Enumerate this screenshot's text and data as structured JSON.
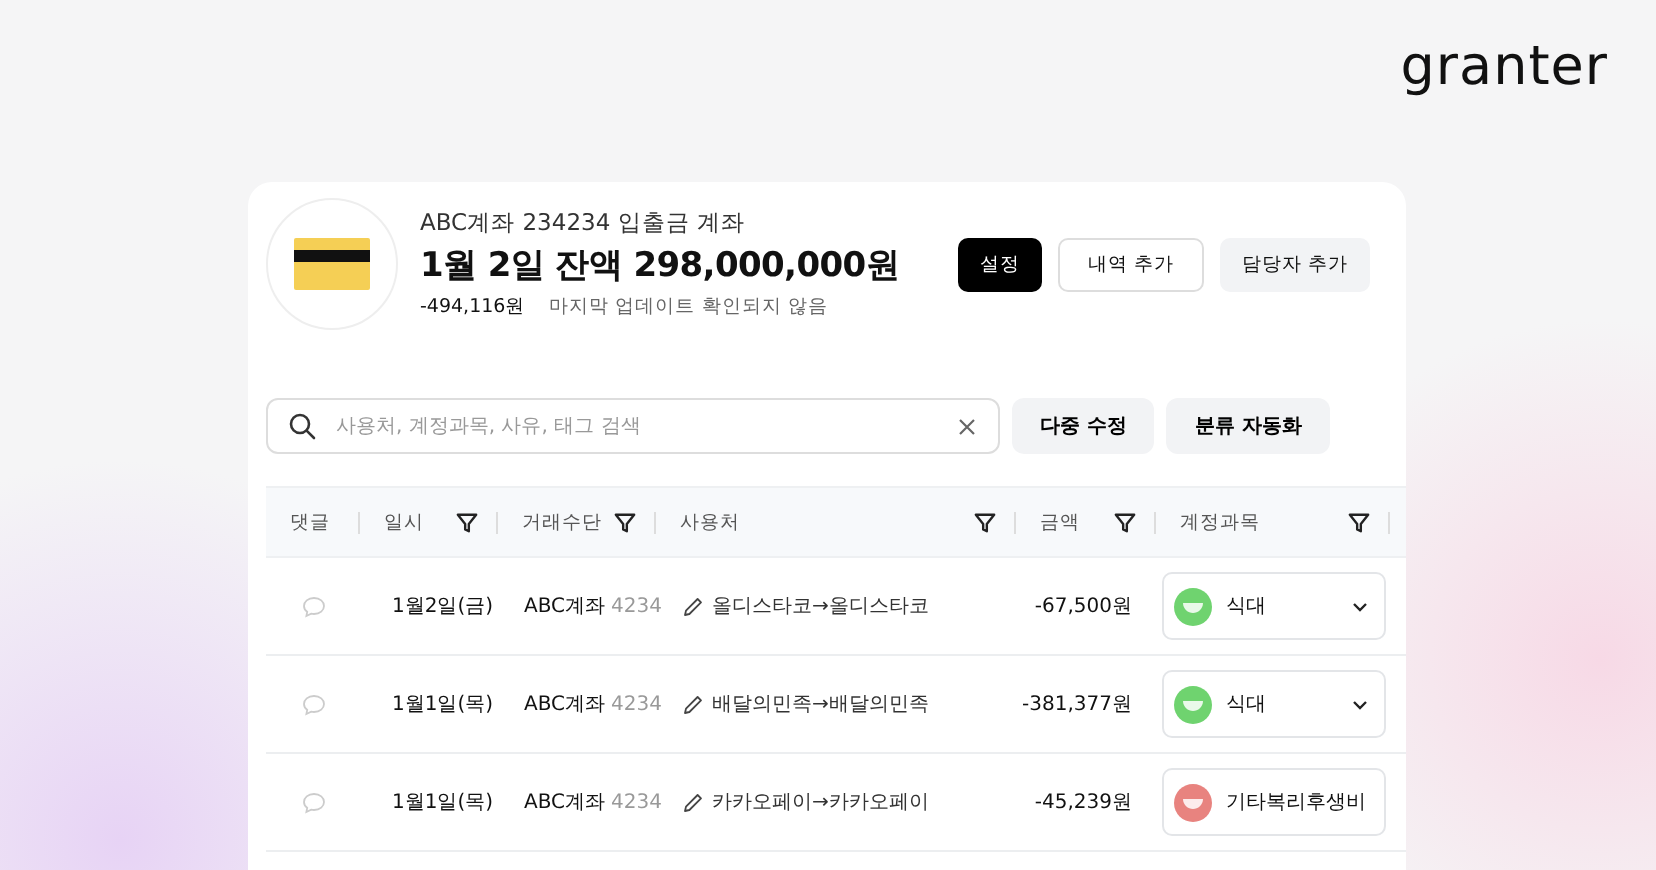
{
  "logo": "granter",
  "account": {
    "name": "ABC계좌 234234 입출금 계좌",
    "balance_title": "1월 2일 잔액 298,000,000원",
    "change": "-494,116원",
    "update_status": "마지막 업데이트 확인되지 않음"
  },
  "header_buttons": [
    {
      "label": "설정",
      "kind": "primary"
    },
    {
      "label": "내역 추가",
      "kind": "outline"
    },
    {
      "label": "담당자 추가",
      "kind": "secondary"
    }
  ],
  "search": {
    "placeholder": "사용처, 계정과목, 사유, 태그 검색"
  },
  "actions": [
    "다중 수정",
    "분류 자동화"
  ],
  "table": {
    "columns": [
      {
        "label": "댓글",
        "filter": false
      },
      {
        "label": "일시",
        "filter": true
      },
      {
        "label": "거래수단",
        "filter": true
      },
      {
        "label": "사용처",
        "filter": true
      },
      {
        "label": "금액",
        "filter": true
      },
      {
        "label": "계정과목",
        "filter": true
      }
    ],
    "rows": [
      {
        "date": "1월2일(금)",
        "method": "ABC계좌",
        "account_no": "4234",
        "merchant": "올디스타코→올디스타코",
        "amount": "-67,500원",
        "category": {
          "label": "식대",
          "color": "#6fd36f"
        }
      },
      {
        "date": "1월1일(목)",
        "method": "ABC계좌",
        "account_no": "4234",
        "merchant": "배달의민족→배달의민족",
        "amount": "-381,377원",
        "category": {
          "label": "식대",
          "color": "#6fd36f"
        }
      },
      {
        "date": "1월1일(목)",
        "method": "ABC계좌",
        "account_no": "4234",
        "merchant": "카카오페이→카카오페이",
        "amount": "-45,239원",
        "category": {
          "label": "기타복리후생비",
          "color": "#e8837f"
        }
      }
    ]
  }
}
